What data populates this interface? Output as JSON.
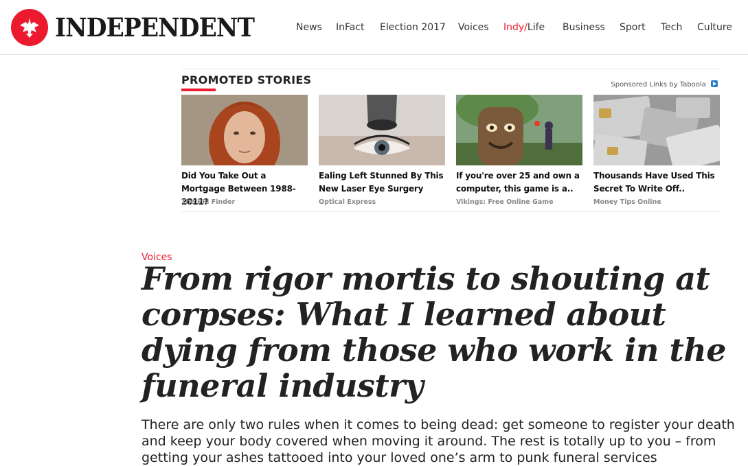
{
  "brand": {
    "name": "INDEPENDENT",
    "logo_icon": "eagle-icon",
    "accent_color": "#ec1a2e"
  },
  "nav": {
    "items": [
      "News",
      "InFact",
      "Election 2017",
      "Voices",
      "Indy/",
      "Life",
      "Business",
      "Sport",
      "Tech",
      "Culture"
    ]
  },
  "promoted": {
    "title": "PROMOTED STORIES",
    "sponsored": "Sponsored Links by Taboola",
    "cards": [
      {
        "headline": "Did You Take Out a Mortgage Between 1988-2011?",
        "source": "The PPI Finder"
      },
      {
        "headline": "Ealing Left Stunned By This New Laser Eye Surgery",
        "source": "Optical Express"
      },
      {
        "headline": "If you're over 25 and own a computer, this game is a..",
        "source": "Vikings: Free Online Game"
      },
      {
        "headline": "Thousands Have Used This Secret To Write Off..",
        "source": "Money Tips Online"
      }
    ]
  },
  "article": {
    "section": "Voices",
    "title": "From rigor mortis to shouting at corpses: What I learned about dying from those who work in the funeral industry",
    "standfirst": "There are only two rules when it comes to being dead: get someone to register your death and keep your body covered when moving it around. The rest is totally up to you – from getting your ashes tattooed into your loved one’s arm to punk funeral services"
  }
}
